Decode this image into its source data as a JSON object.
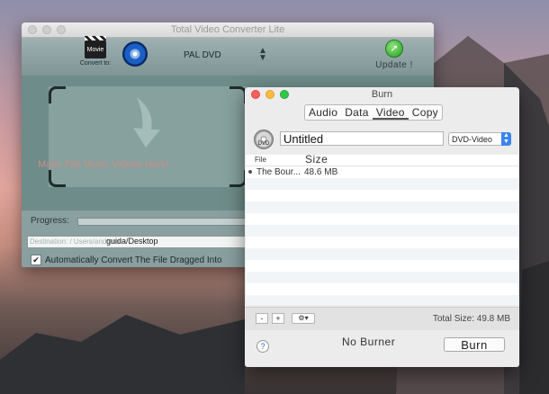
{
  "main_window": {
    "title": "Total Video Converter Lite",
    "toolbar": {
      "movie_icon_text": "Movie",
      "convert_to_label": "Convert to:",
      "preset_value": "PAL DVD",
      "update_label": "Update !"
    },
    "drop_text": "Make File Music Videos Here!",
    "progress_label": "Progress:",
    "destination_label": "Destination: / Users/andress",
    "destination_path": "guida/Desktop",
    "auto_convert_label": "Automatically Convert The File Dragged Into",
    "auto_convert_checked": true
  },
  "burn_window": {
    "title": "Burn",
    "tabs": [
      {
        "label": "Audio"
      },
      {
        "label": "Data"
      },
      {
        "label": "Video"
      },
      {
        "label": "Copy"
      }
    ],
    "active_tab": "Video",
    "disc_icon_text": "DVD",
    "disc_name": "Untitled",
    "format_value": "DVD-Video",
    "columns": {
      "file": "File",
      "size": "Size"
    },
    "files": [
      {
        "file": "The Bour...",
        "size": "48.6 MB"
      }
    ],
    "remove_label": "-",
    "add_label": "+",
    "gear_label": "⚙▾",
    "total_size": "Total Size: 49.8 MB",
    "burner_status": "No Burner",
    "burn_button": "Burn",
    "help_label": "?"
  },
  "colors": {
    "main_bg": "#8a9fa0",
    "drop_bg": "#6e8c89",
    "accent_blue": "#3b84f0"
  }
}
